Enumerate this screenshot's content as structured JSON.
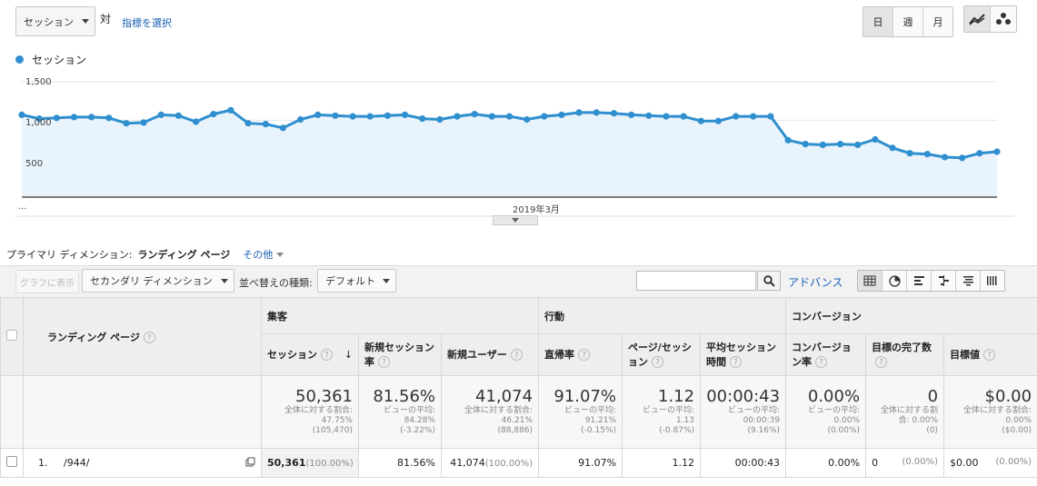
{
  "top": {
    "metric_select": "セッション",
    "vs_label": "対",
    "select_metric_link": "指標を選択",
    "period_buttons": [
      "日",
      "週",
      "月"
    ]
  },
  "chart": {
    "legend_label": "セッション",
    "y_ticks": [
      "1,500",
      "1,000",
      "500"
    ],
    "x_label_left": "...",
    "x_label_mid": "2019年3月"
  },
  "chart_data": {
    "type": "area",
    "series": [
      {
        "name": "セッション",
        "values": [
          1070,
          1020,
          1030,
          1040,
          1040,
          1030,
          960,
          970,
          1070,
          1060,
          980,
          1080,
          1130,
          960,
          950,
          900,
          1010,
          1070,
          1060,
          1050,
          1050,
          1060,
          1070,
          1020,
          1010,
          1050,
          1080,
          1050,
          1050,
          1010,
          1050,
          1070,
          1100,
          1100,
          1090,
          1070,
          1060,
          1050,
          1050,
          990,
          990,
          1050,
          1050,
          1050,
          740,
          690,
          680,
          690,
          680,
          750,
          640,
          570,
          560,
          520,
          510,
          570,
          590
        ],
        "color": "#2f8fcf"
      }
    ],
    "ylim": [
      0,
      1500
    ],
    "grid": true,
    "legend_position": "top-left"
  },
  "dims": {
    "primary_label": "プライマリ ディメンション:",
    "primary_value": "ランディング ページ",
    "other_label": "その他"
  },
  "toolbar": {
    "graph_button": "グラフに表示",
    "secondary_dim": "セカンダリ ディメンション",
    "sort_label": "並べ替えの種類:",
    "sort_value": "デフォルト",
    "search_placeholder": "",
    "advanced_link": "アドバンス"
  },
  "table": {
    "dimension_header": "ランディング ページ",
    "groups": [
      "集客",
      "行動",
      "コンバージョン"
    ],
    "columns": [
      "セッション",
      "新規セッション率",
      "新規ユーザー",
      "直帰率",
      "ページ/セッション",
      "平均セッション時間",
      "コンバージョン率",
      "目標の完了数",
      "目標値"
    ],
    "totals": [
      {
        "value": "50,361",
        "sub1": "全体に対する割合: 47.75%",
        "sub2": "(105,470)"
      },
      {
        "value": "81.56%",
        "sub1": "ビューの平均: 84.28%",
        "sub2": "(-3.22%)"
      },
      {
        "value": "41,074",
        "sub1": "全体に対する割合: 46.21%",
        "sub2": "(88,886)"
      },
      {
        "value": "91.07%",
        "sub1": "ビューの平均: 91.21%",
        "sub2": "(-0.15%)"
      },
      {
        "value": "1.12",
        "sub1": "ビューの平均: 1.13",
        "sub2": "(-0.87%)"
      },
      {
        "value": "00:00:43",
        "sub1": "ビューの平均: 00:00:39",
        "sub2": "(9.16%)"
      },
      {
        "value": "0.00%",
        "sub1": "ビューの平均: 0.00%",
        "sub2": "(0.00%)"
      },
      {
        "value": "0",
        "sub1": "全体に対する割合: 0.00%",
        "sub2": "(0)"
      },
      {
        "value": "$0.00",
        "sub1": "全体に対する割合: 0.00%",
        "sub2": "($0.00)"
      }
    ],
    "rows": [
      {
        "index": "1.",
        "page": "/944/",
        "sessions": "50,361",
        "sessions_pct": "(100.00%)",
        "new_session_rate": "81.56%",
        "new_users": "41,074",
        "new_users_pct": "(100.00%)",
        "bounce_rate": "91.07%",
        "pages_per_session": "1.12",
        "avg_duration": "00:00:43",
        "conv_rate": "0.00%",
        "goal_completions": "0",
        "goal_completions_pct": "(0.00%)",
        "goal_value": "$0.00",
        "goal_value_pct": "(0.00%)"
      }
    ]
  }
}
